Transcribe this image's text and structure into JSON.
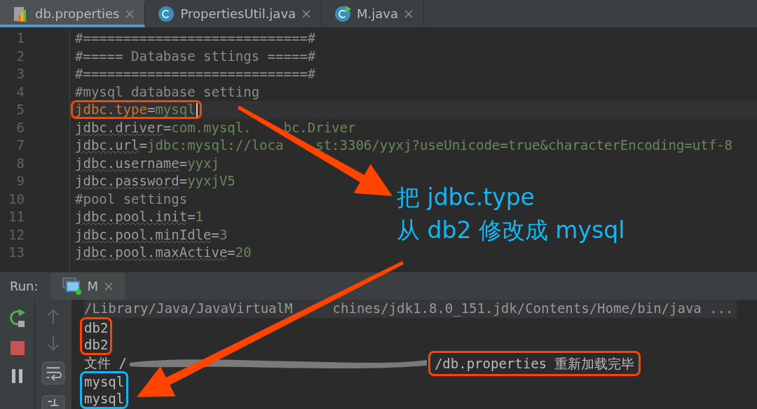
{
  "tabs": [
    {
      "label": "db.properties",
      "kind": "properties",
      "selected": true
    },
    {
      "label": "PropertiesUtil.java",
      "kind": "class",
      "selected": false
    },
    {
      "label": "M.java",
      "kind": "runnable-class",
      "selected": false
    }
  ],
  "editor": {
    "lines": [
      {
        "number": "1",
        "kind": "comment",
        "segments": [
          "#============================#"
        ],
        "current": false
      },
      {
        "number": "2",
        "kind": "comment",
        "segments": [
          "#===== Database sttings =====#"
        ],
        "current": false
      },
      {
        "number": "3",
        "kind": "comment",
        "segments": [
          "#============================#"
        ],
        "current": false
      },
      {
        "number": "4",
        "kind": "comment",
        "segments": [
          "#mysql database setting"
        ],
        "current": false
      },
      {
        "number": "5",
        "kind": "property",
        "segments": [
          "jdbc.type=mysql"
        ],
        "current": true,
        "color": "#ff4400"
      },
      {
        "number": "6",
        "kind": "property",
        "segments": [
          "jdbc.driver=com.mysql.",
          "bc.Driver"
        ],
        "current": false
      },
      {
        "number": "7",
        "kind": "property",
        "segments": [
          "jdbc.url=jdbc:mysql://loca",
          "st:3306/yyxj?useUnicode=true&characterEncoding=utf-8"
        ],
        "current": false
      },
      {
        "number": "8",
        "kind": "property",
        "segments": [
          "jdbc.username=yyxj"
        ],
        "current": false
      },
      {
        "number": "9",
        "kind": "property",
        "segments": [
          "jdbc.password=yyxjV5"
        ],
        "current": false
      },
      {
        "number": "10",
        "kind": "comment",
        "segments": [
          "#pool settings"
        ],
        "current": false
      },
      {
        "number": "11",
        "kind": "property",
        "segments": [
          "jdbc.pool.init=1"
        ],
        "current": false
      },
      {
        "number": "12",
        "kind": "property",
        "segments": [
          "jdbc.pool.minIdle=3"
        ],
        "current": false
      },
      {
        "number": "13",
        "kind": "property",
        "segments": [
          "jdbc.pool.maxActive=20"
        ],
        "current": false
      }
    ]
  },
  "run_panel": {
    "label": "Run:",
    "tab": {
      "label": "M"
    },
    "output": [
      {
        "kind": "command",
        "segments": [
          "/Library/Java/JavaVirtualM",
          "chines/jdk1.8.0_151.jdk/Contents/Home/bin/java ..."
        ]
      },
      {
        "kind": "group",
        "color": "#ff4400",
        "lines": [
          "db2",
          "db2"
        ]
      },
      {
        "kind": "reload",
        "prefix": "文件 /",
        "text": "/db.properties 重新加载完毕",
        "color": "#ff4400"
      },
      {
        "kind": "group",
        "color": "#1ab2f0",
        "lines": [
          "mysql",
          "mysql"
        ]
      }
    ]
  },
  "annotation": {
    "lines": [
      "把 jdbc.type",
      "从 db2 修改成 mysql"
    ]
  }
}
